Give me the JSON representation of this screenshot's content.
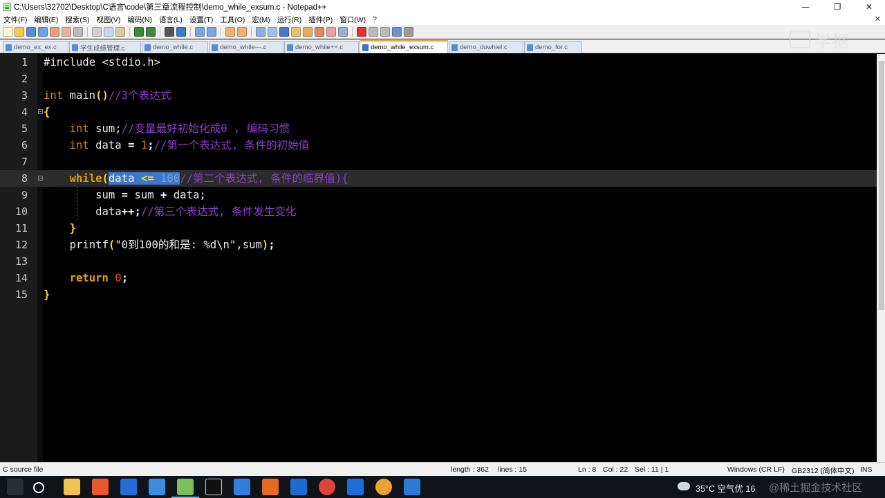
{
  "window": {
    "title": "C:\\Users\\32702\\Desktop\\C语言\\code\\第三章流程控制\\demo_while_exsum.c - Notepad++",
    "controls": {
      "minimize": "—",
      "restore": "❐",
      "close": "✕"
    }
  },
  "menu": {
    "items": [
      "文件(F)",
      "编辑(E)",
      "搜索(S)",
      "视图(V)",
      "编码(N)",
      "语言(L)",
      "设置(T)",
      "工具(O)",
      "宏(M)",
      "运行(R)",
      "插件(P)",
      "窗口(W)",
      "?"
    ],
    "close_glyph": "✕"
  },
  "tabs": [
    {
      "label": "demo_ex_ex.c",
      "active": false
    },
    {
      "label": "学生成绩管理.c",
      "active": false
    },
    {
      "label": "demo_while.c",
      "active": false
    },
    {
      "label": "demo_while—.c",
      "active": false
    },
    {
      "label": "demo_while++.c",
      "active": false
    },
    {
      "label": "demo_while_exsum.c",
      "active": true
    },
    {
      "label": "demo_dowhiel.c",
      "active": false
    },
    {
      "label": "demo_for.c",
      "active": false
    }
  ],
  "watermark_logo": "学据",
  "editor": {
    "line_numbers": [
      "1",
      "2",
      "3",
      "4",
      "5",
      "6",
      "7",
      "8",
      "9",
      "10",
      "11",
      "12",
      "13",
      "14",
      "15"
    ],
    "current_line": 8,
    "code": {
      "l1": "#include <stdio.h>",
      "l3_type": "int",
      "l3_name": " main",
      "l3_paren": "()",
      "l3_comment": "//3个表达式",
      "l4": "{",
      "l5_type": "int",
      "l5_rest": " sum;",
      "l5_comment": "//变量最好初始化成0 , 编码习惯",
      "l6_type": "int",
      "l6_var": " data ",
      "l6_eq": "=",
      "l6_num": " 1",
      "l6_semi": ";",
      "l6_comment": "//第一个表达式, 条件的初始值",
      "l8_kw": "while",
      "l8_paren": "(",
      "l8_sel_a": "data ",
      "l8_sel_op": "<=",
      "l8_sel_num": " 100",
      "l8_comment": "//第二个表达式, 条件的临界值",
      "l8_tail": "){",
      "l9_a": "sum ",
      "l9_eq": "=",
      "l9_b": " sum ",
      "l9_plus": "+",
      "l9_c": " data;",
      "l10_a": "data",
      "l10_op": "++",
      "l10_semi": ";",
      "l10_comment": "//第三个表达式, 条件发生变化",
      "l11": "}",
      "l12_fn": "printf",
      "l12_open": "(",
      "l12_str": "\"0到100的和是: %d\\n\"",
      "l12_rest": ",sum",
      "l12_close": ")",
      "l12_semi": ";",
      "l14_kw": "return",
      "l14_num": " 0",
      "l14_semi": ";",
      "l15": "}"
    }
  },
  "status": {
    "file_type": "C source file",
    "length": "length : 362",
    "lines": "lines : 15",
    "ln": "Ln : 8",
    "col": "Col : 22",
    "sel": "Sel : 11 | 1",
    "eol": "Windows (CR LF)",
    "encoding": "GB2312 (简体中文)",
    "mode": "INS"
  },
  "taskbar": {
    "weather": "35°C 空气优 16",
    "watermark": "@稀土掘金技术社区"
  }
}
